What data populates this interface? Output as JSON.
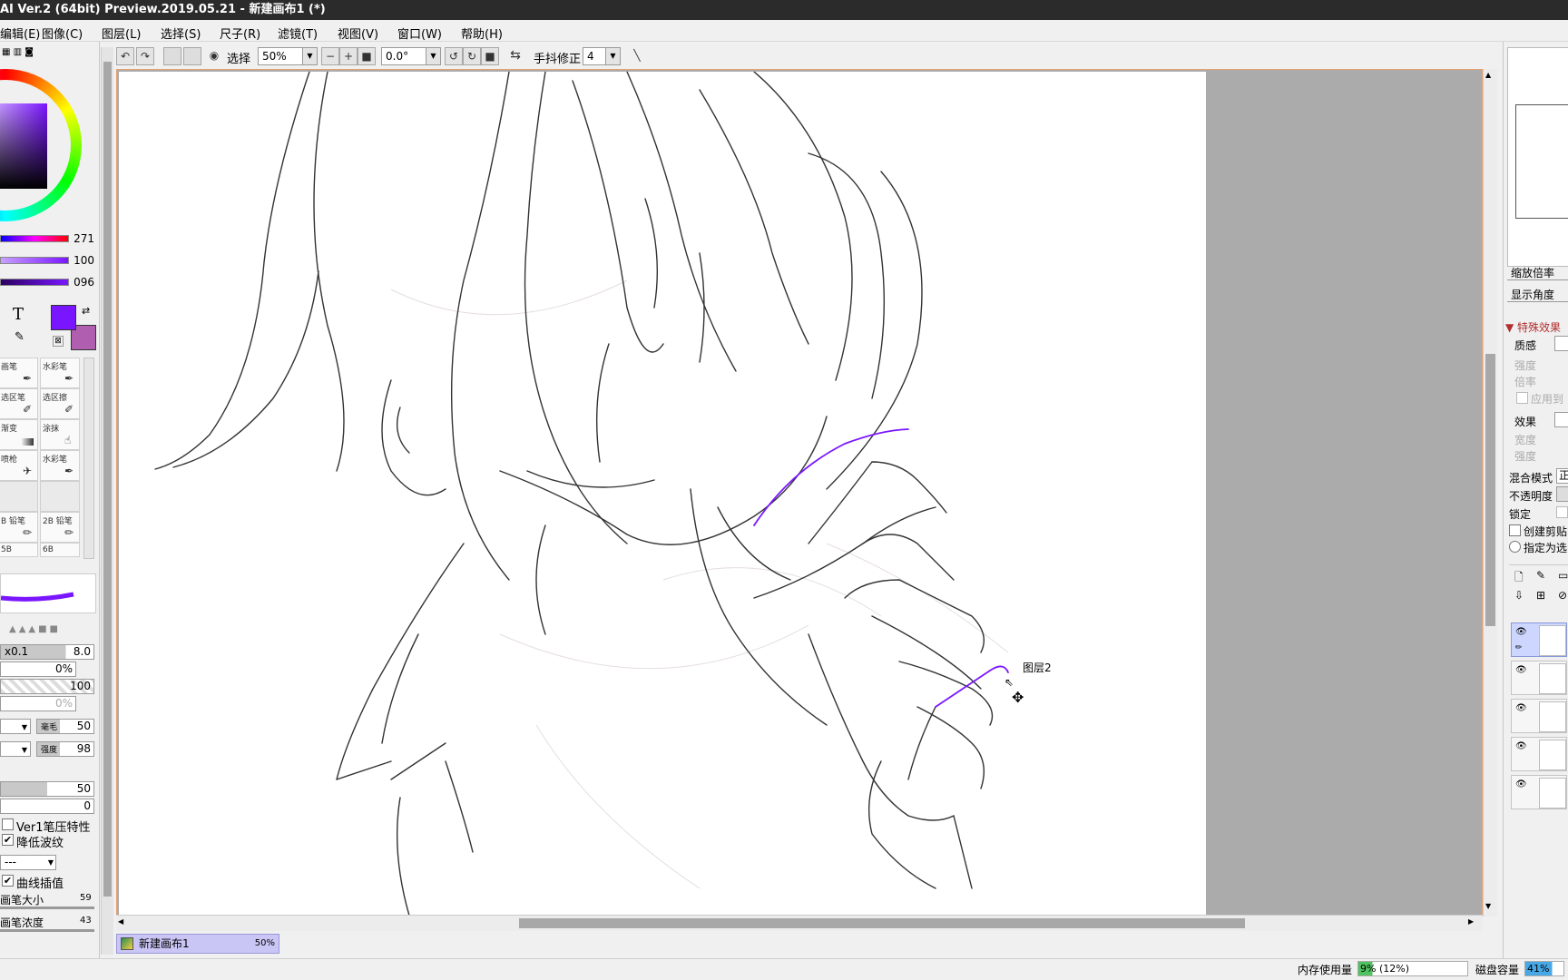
{
  "window": {
    "title": "AI Ver.2 (64bit) Preview.2019.05.21 - 新建画布1 (*)"
  },
  "menu": {
    "items": [
      "编辑(E)",
      "图像(C)",
      "图层(L)",
      "选择(S)",
      "尺子(R)",
      "滤镜(T)",
      "视图(V)",
      "窗口(W)",
      "帮助(H)"
    ]
  },
  "toolbar": {
    "select_label": "选择",
    "zoom_value": "50%",
    "rotation_value": "0.0°",
    "stabilizer_label": "手抖修正",
    "stabilizer_value": "4"
  },
  "color": {
    "hue": "271",
    "saturation": "100",
    "value": "096",
    "fg": "#7a16ff",
    "bg": "#b05fb0"
  },
  "brushes": [
    {
      "label": "画笔",
      "icon": "brush-icon"
    },
    {
      "label": "水彩笔",
      "icon": "watercolor-icon"
    },
    {
      "label": "选区笔",
      "icon": "selection-pen-icon"
    },
    {
      "label": "选区擦",
      "icon": "selection-eraser-icon"
    },
    {
      "label": "渐变",
      "icon": "gradient-icon"
    },
    {
      "label": "涂抹",
      "icon": "smudge-icon"
    },
    {
      "label": "喷枪",
      "icon": "airbrush-icon"
    },
    {
      "label": "水彩笔",
      "icon": "watercolor-icon"
    },
    {
      "label": "B 铅笔",
      "icon": "pencil-icon"
    },
    {
      "label": "2B 铅笔",
      "icon": "pencil-icon"
    },
    {
      "label": "5B",
      "icon": ""
    },
    {
      "label": "6B",
      "icon": ""
    }
  ],
  "brush_settings": {
    "size_mult": "x0.1",
    "size_value": "8.0",
    "min_size": "0%",
    "density": "100",
    "min_density": "0%",
    "bristle_label": "毫毛",
    "bristle_value": "50",
    "strength_label": "强度",
    "strength_value": "98",
    "blending": "50",
    "dilution": "0",
    "ver1_label": "Ver1笔压特性",
    "reduce_moire_label": "降低波纹",
    "dropdown_value": "---",
    "curve_label": "曲线插值",
    "pen_size_label": "画笔大小",
    "pen_size_value": "59",
    "pen_density_label": "画笔浓度",
    "pen_density_value": "43"
  },
  "right_panel": {
    "zoom_label": "缩放倍率",
    "angle_label": "显示角度",
    "effects_header": "特殊效果",
    "texture_label": "质感",
    "intensity_label": "强度",
    "scale_label": "倍率",
    "apply_label": "应用到",
    "effect_label": "效果",
    "width_label": "宽度",
    "strength_label": "强度",
    "blend_label": "混合模式",
    "blend_value": "正",
    "opacity_label": "不透明度",
    "lock_label": "锁定",
    "clip_label": "创建剪贴",
    "select_src_label": "指定为选"
  },
  "canvas": {
    "layer_tooltip": "图层2"
  },
  "document_tab": {
    "name": "新建画布1",
    "zoom": "50%"
  },
  "status": {
    "memory_label": "内存使用量",
    "memory_value": "9% (12%)",
    "disk_label": "磁盘容量",
    "disk_value": "41%"
  }
}
